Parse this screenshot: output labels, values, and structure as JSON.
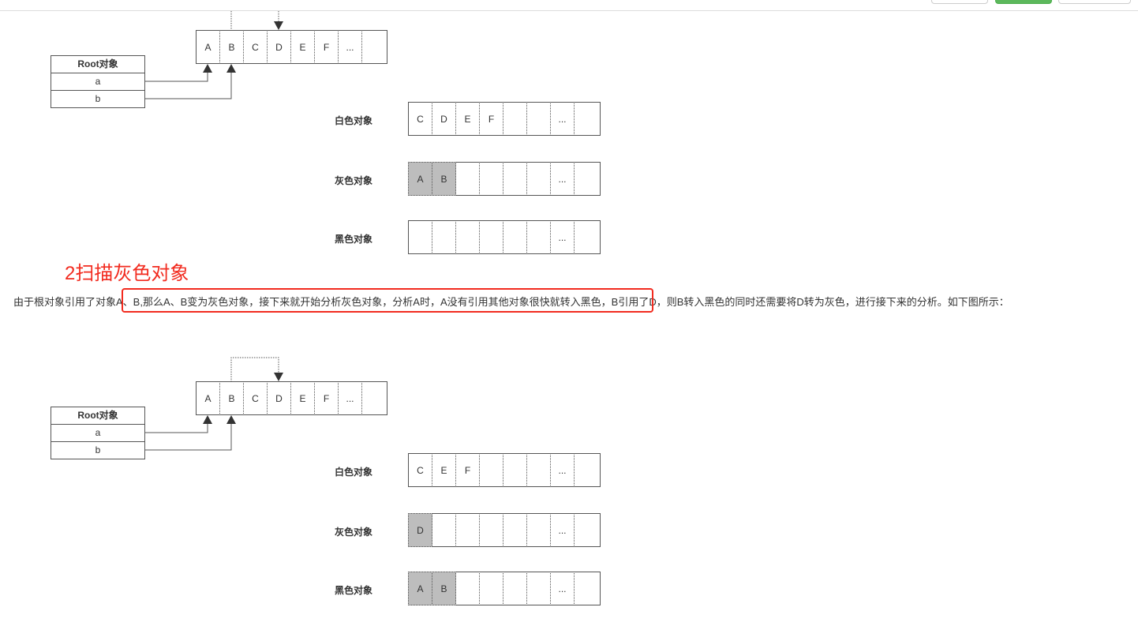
{
  "colors": {
    "heading": "#f22b1f",
    "gray_cell": "#bdbdbd",
    "button_green": "#5cb85c"
  },
  "heading": "2扫描灰色对象",
  "paragraph": {
    "before": "由于根对象引用了对象",
    "highlight": "A、B,那么A、B变为灰色对象，接下来就开始分析灰色对象，分析A时，A没有引用其他对象很快就转入黑色，",
    "after": "B引用了D，则B转入黑色的同时还需要将D转为灰色，进行接下来的分析。如下图所示："
  },
  "diagrams": [
    {
      "root": {
        "title": "Root对象",
        "fields": [
          "a",
          "b"
        ]
      },
      "heap": [
        "A",
        "B",
        "C",
        "D",
        "E",
        "F",
        "..."
      ],
      "sets": [
        {
          "label": "白色对象",
          "cells": [
            "C",
            "D",
            "E",
            "F",
            "",
            "",
            "..."
          ],
          "gray": []
        },
        {
          "label": "灰色对象",
          "cells": [
            "A",
            "B",
            "",
            "",
            "",
            "",
            "..."
          ],
          "gray": [
            0,
            1
          ]
        },
        {
          "label": "黑色对象",
          "cells": [
            "",
            "",
            "",
            "",
            "",
            "",
            "..."
          ],
          "gray": []
        }
      ]
    },
    {
      "root": {
        "title": "Root对象",
        "fields": [
          "a",
          "b"
        ]
      },
      "heap": [
        "A",
        "B",
        "C",
        "D",
        "E",
        "F",
        "..."
      ],
      "sets": [
        {
          "label": "白色对象",
          "cells": [
            "C",
            "E",
            "F",
            "",
            "",
            "",
            "..."
          ],
          "gray": []
        },
        {
          "label": "灰色对象",
          "cells": [
            "D",
            "",
            "",
            "",
            "",
            "",
            "..."
          ],
          "gray": [
            0
          ]
        },
        {
          "label": "黑色对象",
          "cells": [
            "A",
            "B",
            "",
            "",
            "",
            "",
            "..."
          ],
          "gray": [
            0,
            1
          ]
        }
      ]
    }
  ]
}
